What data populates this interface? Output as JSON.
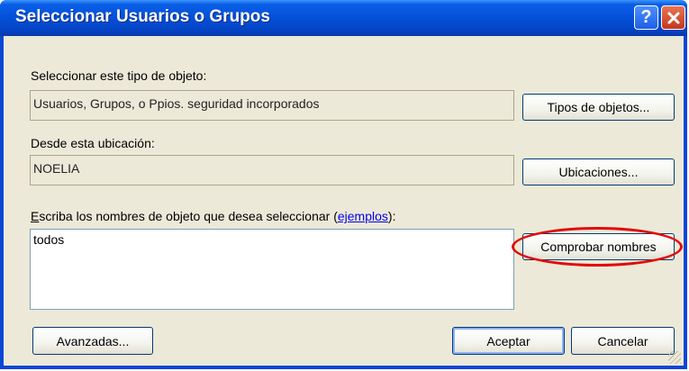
{
  "window": {
    "title": "Seleccionar Usuarios o Grupos",
    "help_button": "?",
    "close_button": "✕"
  },
  "object_type": {
    "label": "Seleccionar este tipo de objeto:",
    "value": "Usuarios, Grupos, o Ppios. seguridad incorporados",
    "button": "Tipos de objetos..."
  },
  "location": {
    "label": "Desde esta ubicación:",
    "value": "NOELIA",
    "button": "Ubicaciones..."
  },
  "names": {
    "label_accel": "E",
    "label_rest": "scriba los nombres de objeto que desea seleccionar (",
    "link": "ejemplos",
    "label_end": "):",
    "value": "todos",
    "check_button": "Comprobar nombres"
  },
  "footer": {
    "advanced_button": "Avanzadas...",
    "ok_button": "Aceptar",
    "cancel_button": "Cancelar"
  },
  "colors": {
    "titlebar": "#0450d8",
    "dialog_bg": "#ece9d8",
    "highlight_ellipse": "#e20a0a"
  }
}
